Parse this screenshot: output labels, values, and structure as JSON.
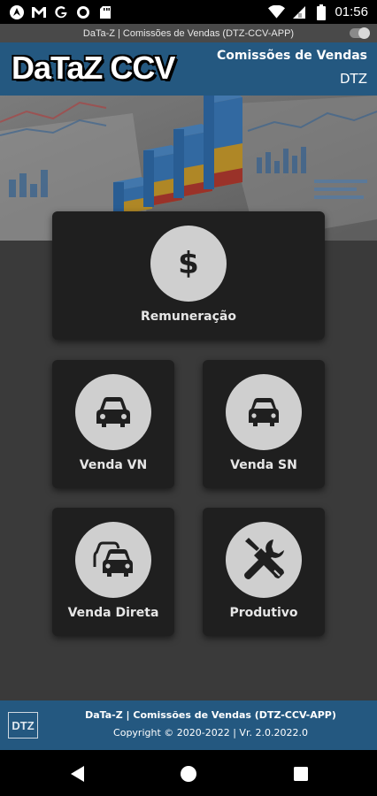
{
  "status_bar": {
    "time": "01:56",
    "icons": [
      "android-auto-icon",
      "gmail-icon",
      "google-icon",
      "circle-icon",
      "sd-card-icon",
      "wifi-icon",
      "signal-icon",
      "battery-icon"
    ]
  },
  "title_strip": {
    "text": "DaTa-Z | Comissões de Vendas (DTZ-CCV-APP)"
  },
  "header": {
    "logo_text": "DaTaZ CCV",
    "title": "Comissões de Vendas",
    "subtitle": "DTZ",
    "color": "#245880"
  },
  "menu": {
    "remuneracao": {
      "label": "Remuneração",
      "icon": "dollar-icon"
    },
    "venda_vn": {
      "label": "Venda VN",
      "icon": "car-front-icon"
    },
    "venda_sn": {
      "label": "Venda SN",
      "icon": "car-front-icon"
    },
    "venda_direta": {
      "label": "Venda Direta",
      "icon": "cars-icon"
    },
    "produtivo": {
      "label": "Produtivo",
      "icon": "tools-icon"
    }
  },
  "footer": {
    "logo_text": "DTZ",
    "line1": "DaTa-Z | Comissões de Vendas (DTZ-CCV-APP)",
    "line2": "Copyright © 2020-2022 | Vr. 2.0.2022.0"
  }
}
